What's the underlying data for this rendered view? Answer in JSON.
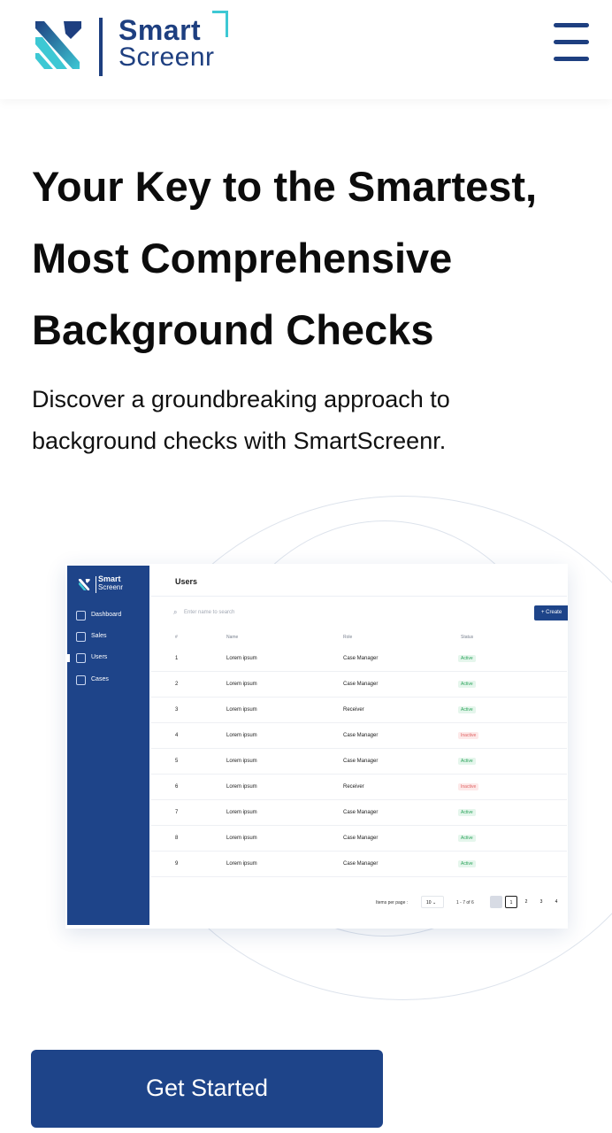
{
  "header": {
    "logo_line1": "Smart",
    "logo_line2": "Screenr",
    "menu_icon": "hamburger-menu-icon"
  },
  "hero": {
    "title": "Your Key to the Smartest, Most Comprehensive Background Checks",
    "subtitle": "Discover a groundbreaking approach to background checks with SmartScreenr."
  },
  "preview": {
    "sidebar": {
      "logo_line1": "Smart",
      "logo_line2": "Screenr",
      "items": [
        {
          "label": "Dashboard",
          "icon": "dashboard-icon"
        },
        {
          "label": "Sales",
          "icon": "bar-chart-icon"
        },
        {
          "label": "Users",
          "icon": "users-icon"
        },
        {
          "label": "Cases",
          "icon": "document-icon"
        }
      ]
    },
    "page_title": "Users",
    "search_placeholder": "Enter name to search",
    "create_label": "+ Create",
    "columns": [
      "#",
      "Name",
      "Role",
      "Status"
    ],
    "rows": [
      {
        "num": "1",
        "name": "Lorem ipsum",
        "role": "Case Manager",
        "status": "Active"
      },
      {
        "num": "2",
        "name": "Lorem ipsum",
        "role": "Case Manager",
        "status": "Active"
      },
      {
        "num": "3",
        "name": "Lorem ipsum",
        "role": "Receiver",
        "status": "Active"
      },
      {
        "num": "4",
        "name": "Lorem ipsum",
        "role": "Case Manager",
        "status": "Inactive"
      },
      {
        "num": "5",
        "name": "Lorem ipsum",
        "role": "Case Manager",
        "status": "Active"
      },
      {
        "num": "6",
        "name": "Lorem ipsum",
        "role": "Receiver",
        "status": "Inactive"
      },
      {
        "num": "7",
        "name": "Lorem ipsum",
        "role": "Case Manager",
        "status": "Active"
      },
      {
        "num": "8",
        "name": "Lorem ipsum",
        "role": "Case Manager",
        "status": "Active"
      },
      {
        "num": "9",
        "name": "Lorem ipsum",
        "role": "Case Manager",
        "status": "Active"
      }
    ],
    "pagination": {
      "items_per_page_label": "Items per page :",
      "items_per_page_value": "10",
      "range": "1 - 7 of 6",
      "pages": [
        "1",
        "2",
        "3",
        "4"
      ],
      "current": "1"
    }
  },
  "cta": {
    "label": "Get Started"
  },
  "colors": {
    "brand": "#1e4489",
    "accent": "#3dc8d4",
    "active": "#2aa35a",
    "inactive": "#e06464"
  }
}
